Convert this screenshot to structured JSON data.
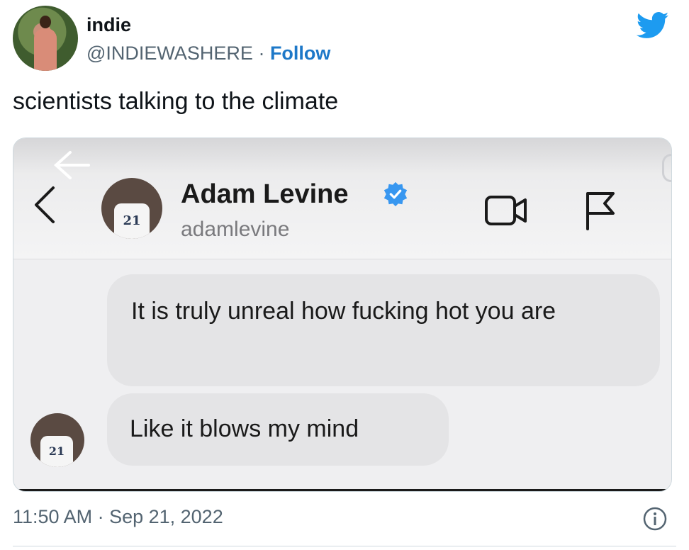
{
  "author": {
    "display_name": "indie",
    "handle": "@INDIEWASHERE",
    "separator": " · ",
    "follow_label": "Follow"
  },
  "tweet": {
    "text": "scientists talking to the climate",
    "timestamp": "11:50 AM · Sep 21, 2022"
  },
  "media": {
    "contact_name": "Adam Levine",
    "contact_handle": "adamlevine",
    "jersey_number": "21",
    "messages": [
      "It is truly unreal how fucking hot you are",
      "Like it blows my mind"
    ]
  },
  "icons": {
    "twitter_logo": "twitter-bird-icon",
    "verified": "verified-badge-icon",
    "video": "video-camera-icon",
    "flag": "flag-icon",
    "back": "chevron-left-icon",
    "info": "info-icon"
  },
  "colors": {
    "twitter_blue": "#1d9bf0",
    "follow_link": "#1d78c8",
    "bubble": "#e4e4e6",
    "verified_blue": "#3897f0"
  }
}
